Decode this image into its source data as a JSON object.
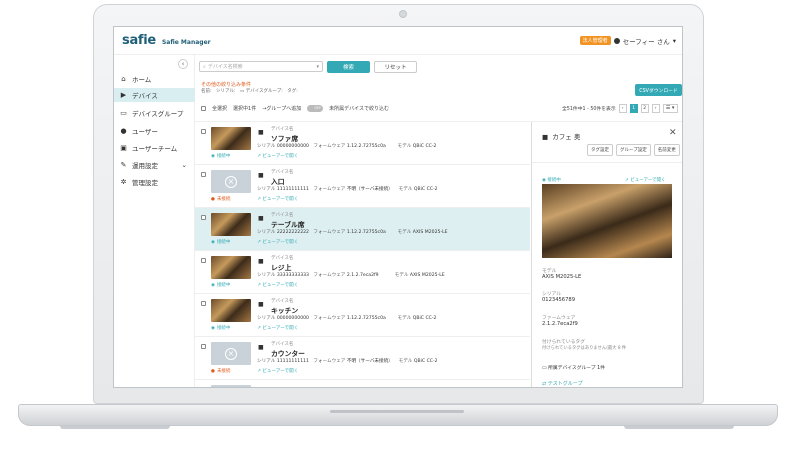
{
  "app": {
    "logo": "safie",
    "subtitle": "Safie Manager",
    "badge": "法人管理者",
    "user": "セーフィー さん",
    "user_caret": "▾"
  },
  "sidebar": {
    "collapse": "‹",
    "items": [
      {
        "icon": "home-icon",
        "glyph": "⌂",
        "label": "ホーム"
      },
      {
        "icon": "camera-icon",
        "glyph": "▶",
        "label": "デバイス",
        "active": true
      },
      {
        "icon": "folder-icon",
        "glyph": "▭",
        "label": "デバイスグループ"
      },
      {
        "icon": "user-icon",
        "glyph": "●",
        "label": "ユーザー"
      },
      {
        "icon": "team-icon",
        "glyph": "▣",
        "label": "ユーザーチーム"
      },
      {
        "icon": "wrench-icon",
        "glyph": "✎",
        "label": "運用設定",
        "caret": "⌄"
      },
      {
        "icon": "gear-icon",
        "glyph": "✲",
        "label": "管理設定"
      }
    ]
  },
  "search": {
    "icon": "⌕",
    "placeholder": "デバイス名検索",
    "caret": "▾",
    "search_label": "検索",
    "reset_label": "リセット"
  },
  "filters": {
    "title": "その他の絞り込み条件",
    "line": "名前:　シリアル:　▭ デバイスグループ:　タグ:"
  },
  "csv_label": "CSVダウンロード",
  "toolbar": {
    "select_all": "全選択",
    "select_action": "選択中1件",
    "add_group": "→グループへ追加",
    "toggle": "OFF",
    "unregistered": "未所属デバイスで絞り込む"
  },
  "paging": {
    "summary": "全51件中1 - 50件を表示",
    "prev": "‹",
    "pages": [
      "1",
      "2"
    ],
    "next": "›",
    "menu": "☰ ▾"
  },
  "devices": [
    {
      "label": "デバイス名",
      "name": "ソファ席",
      "serial_label": "シリアル",
      "serial": "00000000000",
      "fw_label": "フォームウェア",
      "fw": "1.12.2.72755c0a",
      "model_label": "モデル",
      "model": "QBiC CC-2",
      "status": "接続中",
      "online": true,
      "viewer": "ビューアーで開く"
    },
    {
      "label": "デバイス名",
      "name": "入口",
      "serial_label": "シリアル",
      "serial": "11111111111",
      "fw_label": "フォームウェア",
      "fw": "不明（サーバ未接続）",
      "model_label": "モデル",
      "model": "QBiC CC-2",
      "status": "未接続",
      "online": false,
      "viewer": "ビューアーで開く"
    },
    {
      "label": "デバイス名",
      "name": "テーブル席",
      "serial_label": "シリアル",
      "serial": "22222222222",
      "fw_label": "フォームウェア",
      "fw": "1.12.2.72755c0a",
      "model_label": "モデル",
      "model": "AXIS M2025-LE",
      "status": "接続中",
      "online": true,
      "viewer": "ビューアーで開く",
      "selected": true
    },
    {
      "label": "デバイス名",
      "name": "レジ上",
      "serial_label": "シリアル",
      "serial": "33333333333",
      "fw_label": "フォームウェア",
      "fw": "2.1.2.7eca2f9",
      "model_label": "モデル",
      "model": "AXIS M2025-LE",
      "status": "接続中",
      "online": true,
      "viewer": "ビューアーで開く"
    },
    {
      "label": "デバイス名",
      "name": "キッチン",
      "serial_label": "シリアル",
      "serial": "00000000000",
      "fw_label": "フォームウェア",
      "fw": "1.12.2.72755c0a",
      "model_label": "モデル",
      "model": "QBiC CC-2",
      "status": "接続中",
      "online": true,
      "viewer": "ビューアーで開く"
    },
    {
      "label": "デバイス名",
      "name": "カウンター",
      "serial_label": "シリアル",
      "serial": "11111111111",
      "fw_label": "フォームウェア",
      "fw": "不明（サーバ未接続）",
      "model_label": "モデル",
      "model": "QBiC CC-2",
      "status": "未接続",
      "online": false,
      "viewer": "ビューアーで開く"
    }
  ],
  "detail": {
    "title": "カフェ 奥",
    "close": "✕",
    "buttons": [
      "タグ設定",
      "グループ設定",
      "名前変更"
    ],
    "status": "接続中",
    "viewer": "ビューアーで開く",
    "model_label": "モデル",
    "model": "AXIS M2025-LE",
    "serial_label": "シリアル",
    "serial": "0123456789",
    "fw_label": "ファームウェア",
    "fw": "2.1.2.7eca2f9",
    "tags_label": "付けられているタグ",
    "tags_value": "付けられているタグはありません(最大 8 件",
    "groups_label": "所属デバイスグループ 1件",
    "group_link": "テストグループ"
  },
  "colors": {
    "accent": "#33a9b5",
    "warning": "#e05a1a",
    "badge": "#f29423",
    "selected_row": "#ddeff1"
  }
}
